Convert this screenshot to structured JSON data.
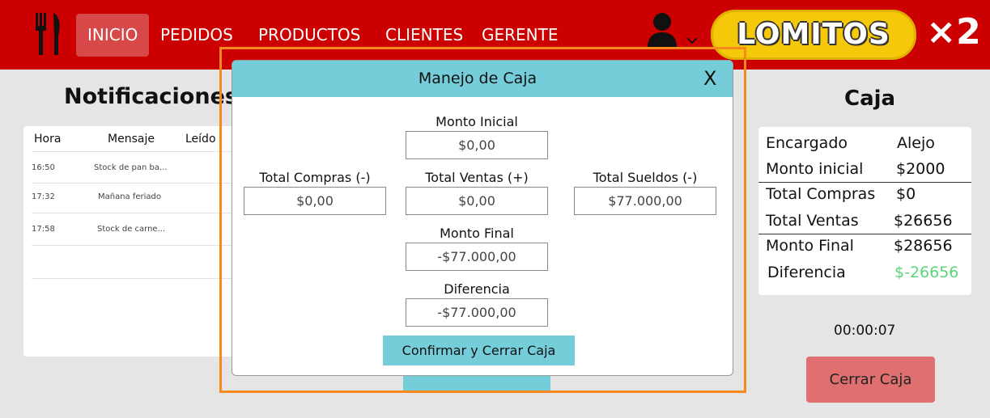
{
  "header": {
    "nav": [
      "INICIO",
      "PEDIDOS",
      "PRODUCTOS",
      "CLIENTES",
      "GERENTE"
    ],
    "logo_text": "LOMITOS",
    "logo_badge": "×2",
    "colors": {
      "header_bg": "#cc0000",
      "accent": "#74cdd8",
      "highlight": "#f68a1e"
    }
  },
  "notifications": {
    "title": "Notificaciones",
    "columns": [
      "Hora",
      "Mensaje",
      "Leído"
    ],
    "rows": [
      {
        "hora": "16:50",
        "mensaje": "Stock de pan ba..."
      },
      {
        "hora": "17:32",
        "mensaje": "Mañana feriado"
      },
      {
        "hora": "17:58",
        "mensaje": "Stock de carne..."
      }
    ]
  },
  "caja": {
    "title": "Caja",
    "rows": [
      {
        "label": "Encargado",
        "value": "Alejo"
      },
      {
        "label": "Monto inicial",
        "value": "$2000"
      },
      {
        "label": "Total Compras",
        "value": "$0"
      },
      {
        "label": "Total Ventas",
        "value": "$26656"
      },
      {
        "label": "Monto Final",
        "value": "$28656"
      },
      {
        "label": "Diferencia",
        "value": "$-26656"
      }
    ],
    "difference_color": "#5ad67a",
    "timer": "00:00:07",
    "close_button": "Cerrar Caja"
  },
  "modal": {
    "title": "Manejo de Caja",
    "close": "X",
    "fields": {
      "monto_inicial": {
        "label": "Monto Inicial",
        "value": "$0,00"
      },
      "total_compras": {
        "label": "Total Compras (-)",
        "value": "$0,00"
      },
      "total_ventas": {
        "label": "Total Ventas (+)",
        "value": "$0,00"
      },
      "total_sueldos": {
        "label": "Total Sueldos (-)",
        "value": "$77.000,00"
      },
      "monto_final": {
        "label": "Monto Final",
        "value": "-$77.000,00"
      },
      "diferencia": {
        "label": "Diferencia",
        "value": "-$77.000,00"
      }
    },
    "confirm_button": "Confirmar y Cerrar Caja"
  }
}
